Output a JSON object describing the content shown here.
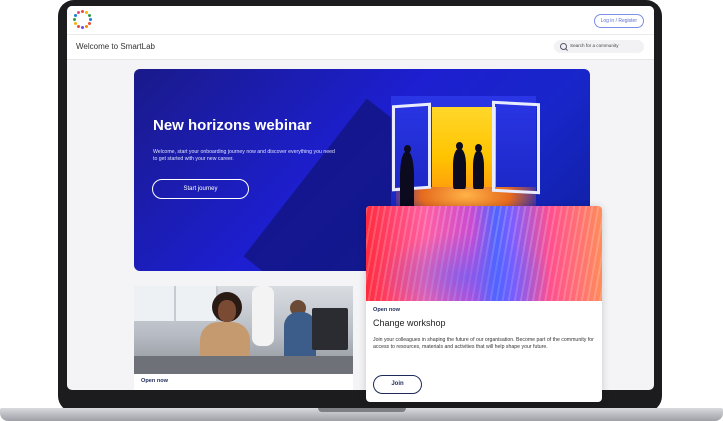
{
  "header": {
    "login_label": "Log in / Register",
    "logo_dot_colors": [
      "#e94b3c",
      "#f2b705",
      "#2f9e44",
      "#1c7ed6",
      "#e94b3c",
      "#f08c00",
      "#7048e8",
      "#e94b3c",
      "#f2b705",
      "#2f9e44",
      "#1c7ed6",
      "#e64980"
    ]
  },
  "subheader": {
    "site_title": "Welcome to SmartLab",
    "search_placeholder": "Search for a community"
  },
  "hero": {
    "title": "New horizons webinar",
    "description": "Welcome, start your onboarding journey now and discover everything you need to get started with your new career.",
    "button_label": "Start journey"
  },
  "cards": [
    {
      "status": "Open now"
    },
    {
      "status": "Open now",
      "title": "Change workshop",
      "description": "Join your colleagues in shaping  the future of our organisation. Become part of the community for access to resources, materials and activities that will help shape your future.",
      "button_label": "Join"
    }
  ]
}
